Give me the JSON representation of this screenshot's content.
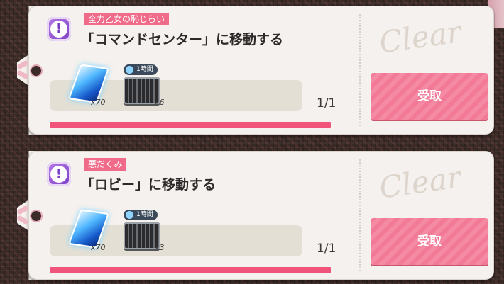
{
  "missions": [
    {
      "tag": "全力乙女の恥じらい",
      "title": "「コマンドセンター」に移動する",
      "rewards": [
        {
          "icon": "crystal-icon",
          "qty": "x70"
        },
        {
          "icon": "chest-icon",
          "qty": "x6",
          "timer": "1時間"
        }
      ],
      "progress": "1/1",
      "progress_fraction": 1.0,
      "stamp": "Clear",
      "button": "受取"
    },
    {
      "tag": "悪だくみ",
      "title": "「ロビー」に移動する",
      "rewards": [
        {
          "icon": "crystal-icon",
          "qty": "x70"
        },
        {
          "icon": "chest-icon",
          "qty": "x3",
          "timer": "1時間"
        }
      ],
      "progress": "1/1",
      "progress_fraction": 1.0,
      "stamp": "Clear",
      "button": "受取"
    }
  ],
  "colors": {
    "accent_pink": "#f06b8a",
    "button_pink": "#f27a96",
    "badge_purple": "#7a3ec4"
  }
}
